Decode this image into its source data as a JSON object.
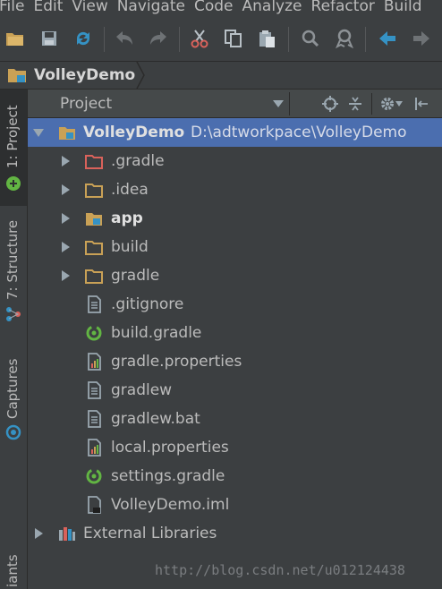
{
  "menu": [
    "File",
    "Edit",
    "View",
    "Navigate",
    "Code",
    "Analyze",
    "Refactor",
    "Build"
  ],
  "toolbar": {
    "buttons": [
      "open-folder-icon",
      "save-icon",
      "sync-icon",
      "undo-icon",
      "redo-icon",
      "cut-icon",
      "copy-icon",
      "paste-icon",
      "find-icon",
      "replace-icon",
      "back-icon",
      "forward-icon"
    ]
  },
  "breadcrumb": {
    "project": "VolleyDemo"
  },
  "left_strip": {
    "project_tab": "1: Project",
    "structure_tab": "7: Structure",
    "captures_tab": "Captures",
    "variants_tab": "iants"
  },
  "panel": {
    "view_label": "Project"
  },
  "tree": {
    "root": {
      "name": "VolleyDemo",
      "path": "D:\\adtworkpace\\VolleyDemo"
    },
    "items": [
      {
        "name": ".gradle",
        "type": "folder-excluded",
        "expandable": true
      },
      {
        "name": ".idea",
        "type": "folder",
        "expandable": true
      },
      {
        "name": "app",
        "type": "module",
        "expandable": true,
        "bold": true
      },
      {
        "name": "build",
        "type": "folder",
        "expandable": true
      },
      {
        "name": "gradle",
        "type": "folder",
        "expandable": true
      },
      {
        "name": ".gitignore",
        "type": "text-file",
        "expandable": false
      },
      {
        "name": "build.gradle",
        "type": "gradle-file",
        "expandable": false
      },
      {
        "name": "gradle.properties",
        "type": "properties-file",
        "expandable": false
      },
      {
        "name": "gradlew",
        "type": "text-file",
        "expandable": false
      },
      {
        "name": "gradlew.bat",
        "type": "text-file",
        "expandable": false
      },
      {
        "name": "local.properties",
        "type": "properties-file",
        "expandable": false
      },
      {
        "name": "settings.gradle",
        "type": "gradle-file",
        "expandable": false
      },
      {
        "name": "VolleyDemo.iml",
        "type": "iml-file",
        "expandable": false
      }
    ],
    "external": "External Libraries"
  },
  "watermark": "http://blog.csdn.net/u012124438",
  "colors": {
    "background": "#3c3f41",
    "selection": "#4b6eaf",
    "folder": "#c9a156",
    "excluded_folder": "#d9625b",
    "blue_icon": "#3592c4",
    "green_icon": "#62b543"
  }
}
